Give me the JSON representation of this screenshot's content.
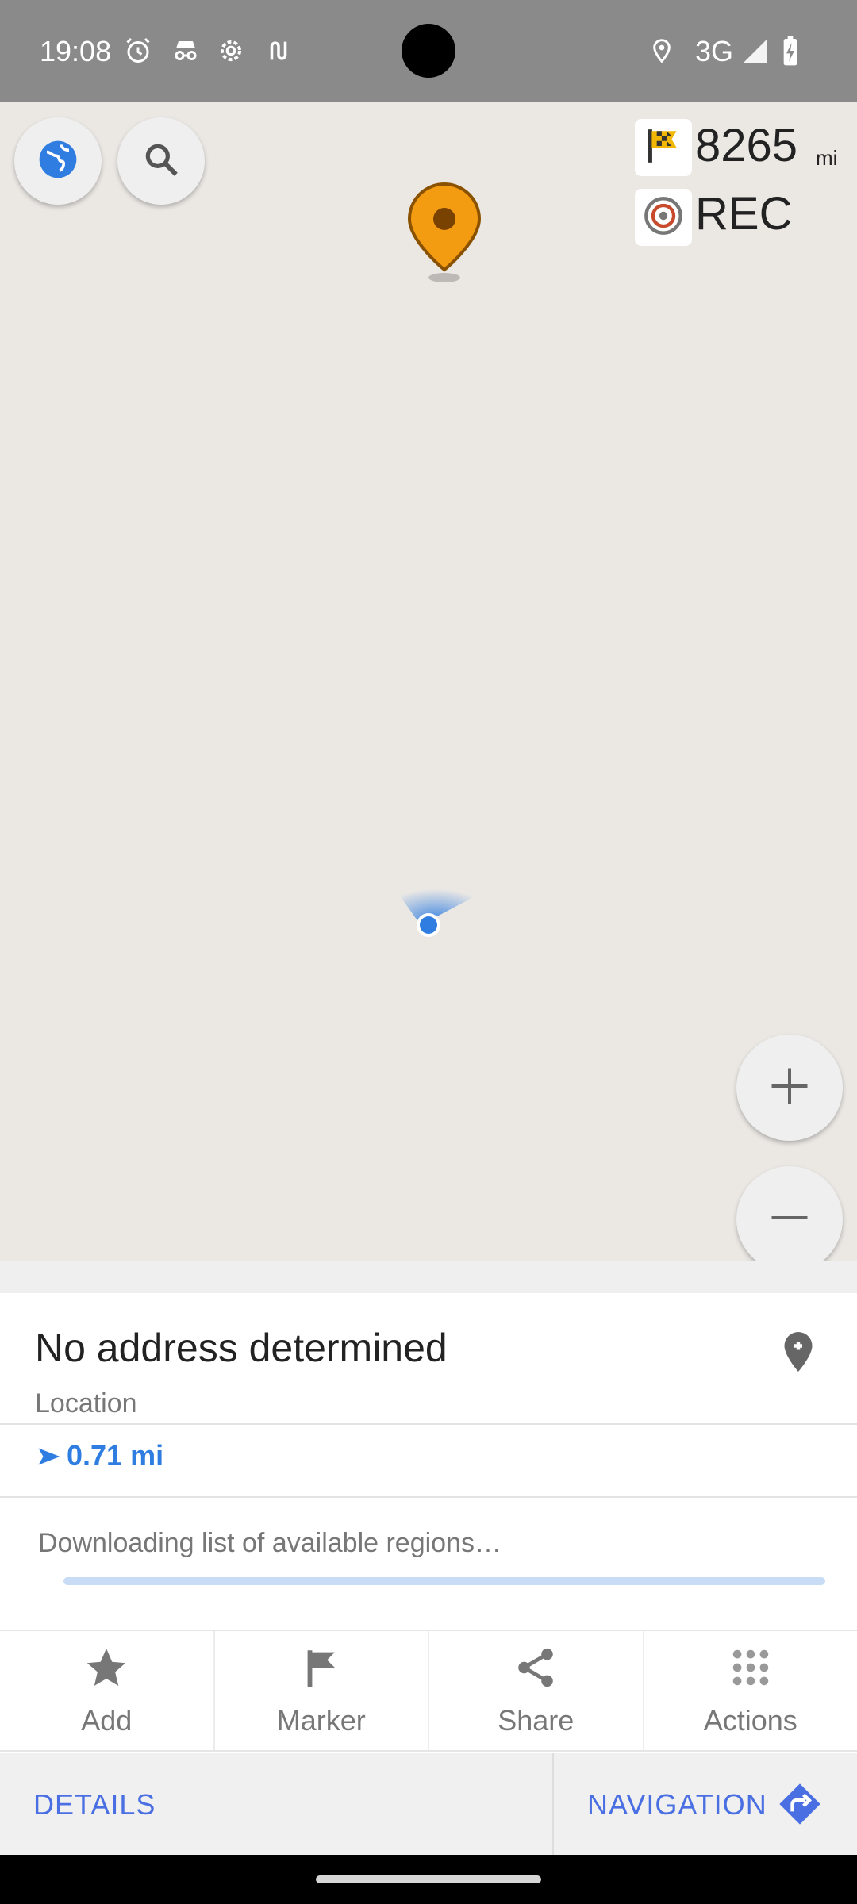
{
  "status_bar": {
    "time": "19:08",
    "network": "3G",
    "icons": [
      "alarm-icon",
      "incognito-icon",
      "settings-cog-icon",
      "route-icon",
      "location-icon",
      "signal-icon",
      "battery-charging-icon"
    ]
  },
  "map": {
    "top_left_buttons": [
      "globe-icon",
      "search-icon"
    ],
    "widgets": {
      "distance_value": "8265",
      "distance_unit": "mi",
      "rec_label": "REC"
    },
    "zoom": [
      "zoom-in-icon",
      "zoom-out-icon"
    ]
  },
  "sheet": {
    "address_title": "No address determined",
    "address_subtitle": "Location",
    "distance": "0.71 mi",
    "download_text": "Downloading list of available regions…",
    "download_progress": 0.0,
    "actions": [
      {
        "label": "Add",
        "icon": "star-icon"
      },
      {
        "label": "Marker",
        "icon": "flag-icon"
      },
      {
        "label": "Share",
        "icon": "share-icon"
      },
      {
        "label": "Actions",
        "icon": "grid-dots-icon"
      }
    ],
    "details_label": "DETAILS",
    "navigation_label": "NAVIGATION"
  },
  "colors": {
    "accent": "#4a6fe3",
    "distance_blue": "#2f7de1",
    "pin_orange": "#f39c12"
  }
}
